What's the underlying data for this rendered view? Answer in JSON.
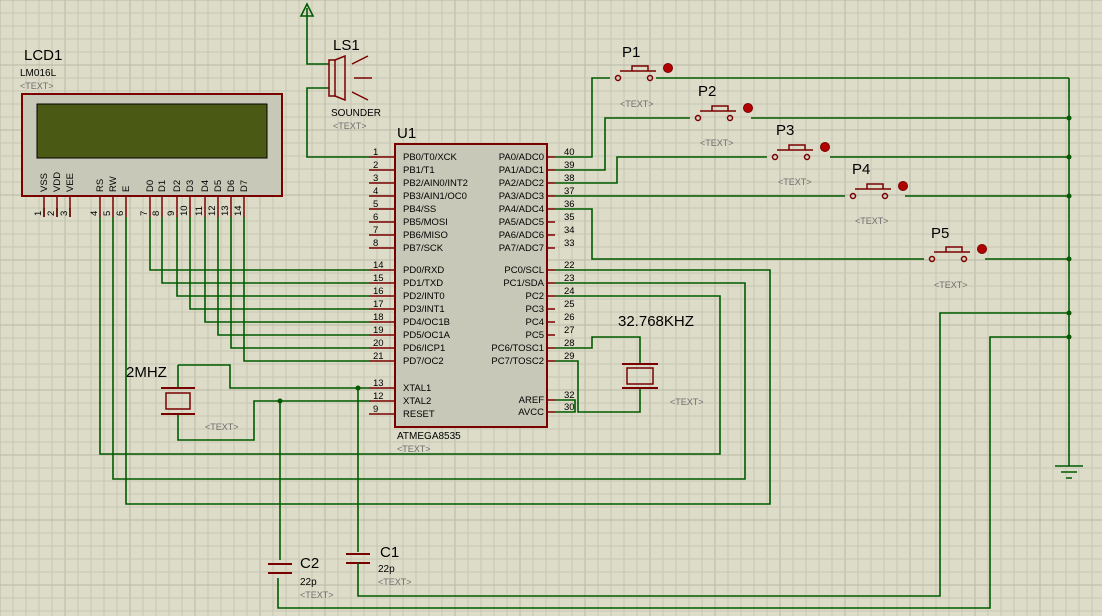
{
  "lcd": {
    "ref": "LCD1",
    "part": "LM016L",
    "placeholder": "<TEXT>",
    "pin_names": [
      "VSS",
      "VDD",
      "VEE",
      "RS",
      "RW",
      "E",
      "D0",
      "D1",
      "D2",
      "D3",
      "D4",
      "D5",
      "D6",
      "D7"
    ],
    "pin_numbers": [
      "1",
      "2",
      "3",
      "4",
      "5",
      "6",
      "7",
      "8",
      "9",
      "10",
      "11",
      "12",
      "13",
      "14"
    ],
    "screen_color": "#4a5a14",
    "body_color": "#c8c8b8"
  },
  "speaker": {
    "ref": "LS1",
    "part": "SOUNDER",
    "placeholder": "<TEXT>"
  },
  "mcu": {
    "ref": "U1",
    "part": "ATMEGA8535",
    "placeholder": "<TEXT>",
    "left_pins": [
      {
        "num": "1",
        "name": "PB0/T0/XCK"
      },
      {
        "num": "2",
        "name": "PB1/T1"
      },
      {
        "num": "3",
        "name": "PB2/AIN0/INT2"
      },
      {
        "num": "4",
        "name": "PB3/AIN1/OC0"
      },
      {
        "num": "5",
        "name": "PB4/SS"
      },
      {
        "num": "6",
        "name": "PB5/MOSI"
      },
      {
        "num": "7",
        "name": "PB6/MISO"
      },
      {
        "num": "8",
        "name": "PB7/SCK"
      },
      {
        "num": "14",
        "name": "PD0/RXD"
      },
      {
        "num": "15",
        "name": "PD1/TXD"
      },
      {
        "num": "16",
        "name": "PD2/INT0"
      },
      {
        "num": "17",
        "name": "PD3/INT1"
      },
      {
        "num": "18",
        "name": "PD4/OC1B"
      },
      {
        "num": "19",
        "name": "PD5/OC1A"
      },
      {
        "num": "20",
        "name": "PD6/ICP1"
      },
      {
        "num": "21",
        "name": "PD7/OC2"
      },
      {
        "num": "13",
        "name": "XTAL1"
      },
      {
        "num": "12",
        "name": "XTAL2"
      },
      {
        "num": "9",
        "name": "RESET"
      }
    ],
    "right_pins": [
      {
        "num": "40",
        "name": "PA0/ADC0"
      },
      {
        "num": "39",
        "name": "PA1/ADC1"
      },
      {
        "num": "38",
        "name": "PA2/ADC2"
      },
      {
        "num": "37",
        "name": "PA3/ADC3"
      },
      {
        "num": "36",
        "name": "PA4/ADC4"
      },
      {
        "num": "35",
        "name": "PA5/ADC5"
      },
      {
        "num": "34",
        "name": "PA6/ADC6"
      },
      {
        "num": "33",
        "name": "PA7/ADC7"
      },
      {
        "num": "22",
        "name": "PC0/SCL"
      },
      {
        "num": "23",
        "name": "PC1/SDA"
      },
      {
        "num": "24",
        "name": "PC2"
      },
      {
        "num": "25",
        "name": "PC3"
      },
      {
        "num": "26",
        "name": "PC4"
      },
      {
        "num": "27",
        "name": "PC5"
      },
      {
        "num": "28",
        "name": "PC6/TOSC1"
      },
      {
        "num": "29",
        "name": "PC7/TOSC2"
      },
      {
        "num": "32",
        "name": "AREF"
      },
      {
        "num": "30",
        "name": "AVCC"
      }
    ]
  },
  "buttons": [
    {
      "ref": "P1",
      "placeholder": "<TEXT>"
    },
    {
      "ref": "P2",
      "placeholder": "<TEXT>"
    },
    {
      "ref": "P3",
      "placeholder": "<TEXT>"
    },
    {
      "ref": "P4",
      "placeholder": "<TEXT>"
    },
    {
      "ref": "P5",
      "placeholder": "<TEXT>"
    }
  ],
  "crystal_main": {
    "value": "2MHZ",
    "placeholder": "<TEXT>"
  },
  "crystal_rtc": {
    "value": "32.768KHZ",
    "placeholder": "<TEXT>"
  },
  "capacitors": [
    {
      "ref": "C1",
      "value": "22p",
      "placeholder": "<TEXT>"
    },
    {
      "ref": "C2",
      "value": "22p",
      "placeholder": "<TEXT>"
    }
  ],
  "colors": {
    "background": "#dcdcc8",
    "wire": "#005a00",
    "component": "#7a0000",
    "junction": "#005a00",
    "button_dot": "#b00000"
  }
}
